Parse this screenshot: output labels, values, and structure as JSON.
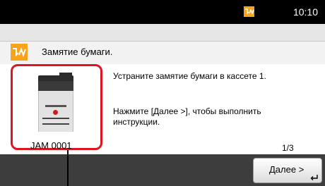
{
  "status": {
    "time": "10:10",
    "warning_icon": "error-warning-icon",
    "warning_color": "#f7a31c"
  },
  "message": {
    "icon": "paper-jam-icon",
    "title": "Замятие бумаги."
  },
  "jam": {
    "code": "JAM 0001",
    "highlight_color": "#e0141e"
  },
  "instructions": {
    "line1": "Устраните замятие бумаги в кассете 1.",
    "line2": "Нажмите [Далее >], чтобы выполнить инструкции."
  },
  "pagination": {
    "indicator": "1/3"
  },
  "buttons": {
    "next_label": "Далее >",
    "next_icon": "enter-icon"
  }
}
